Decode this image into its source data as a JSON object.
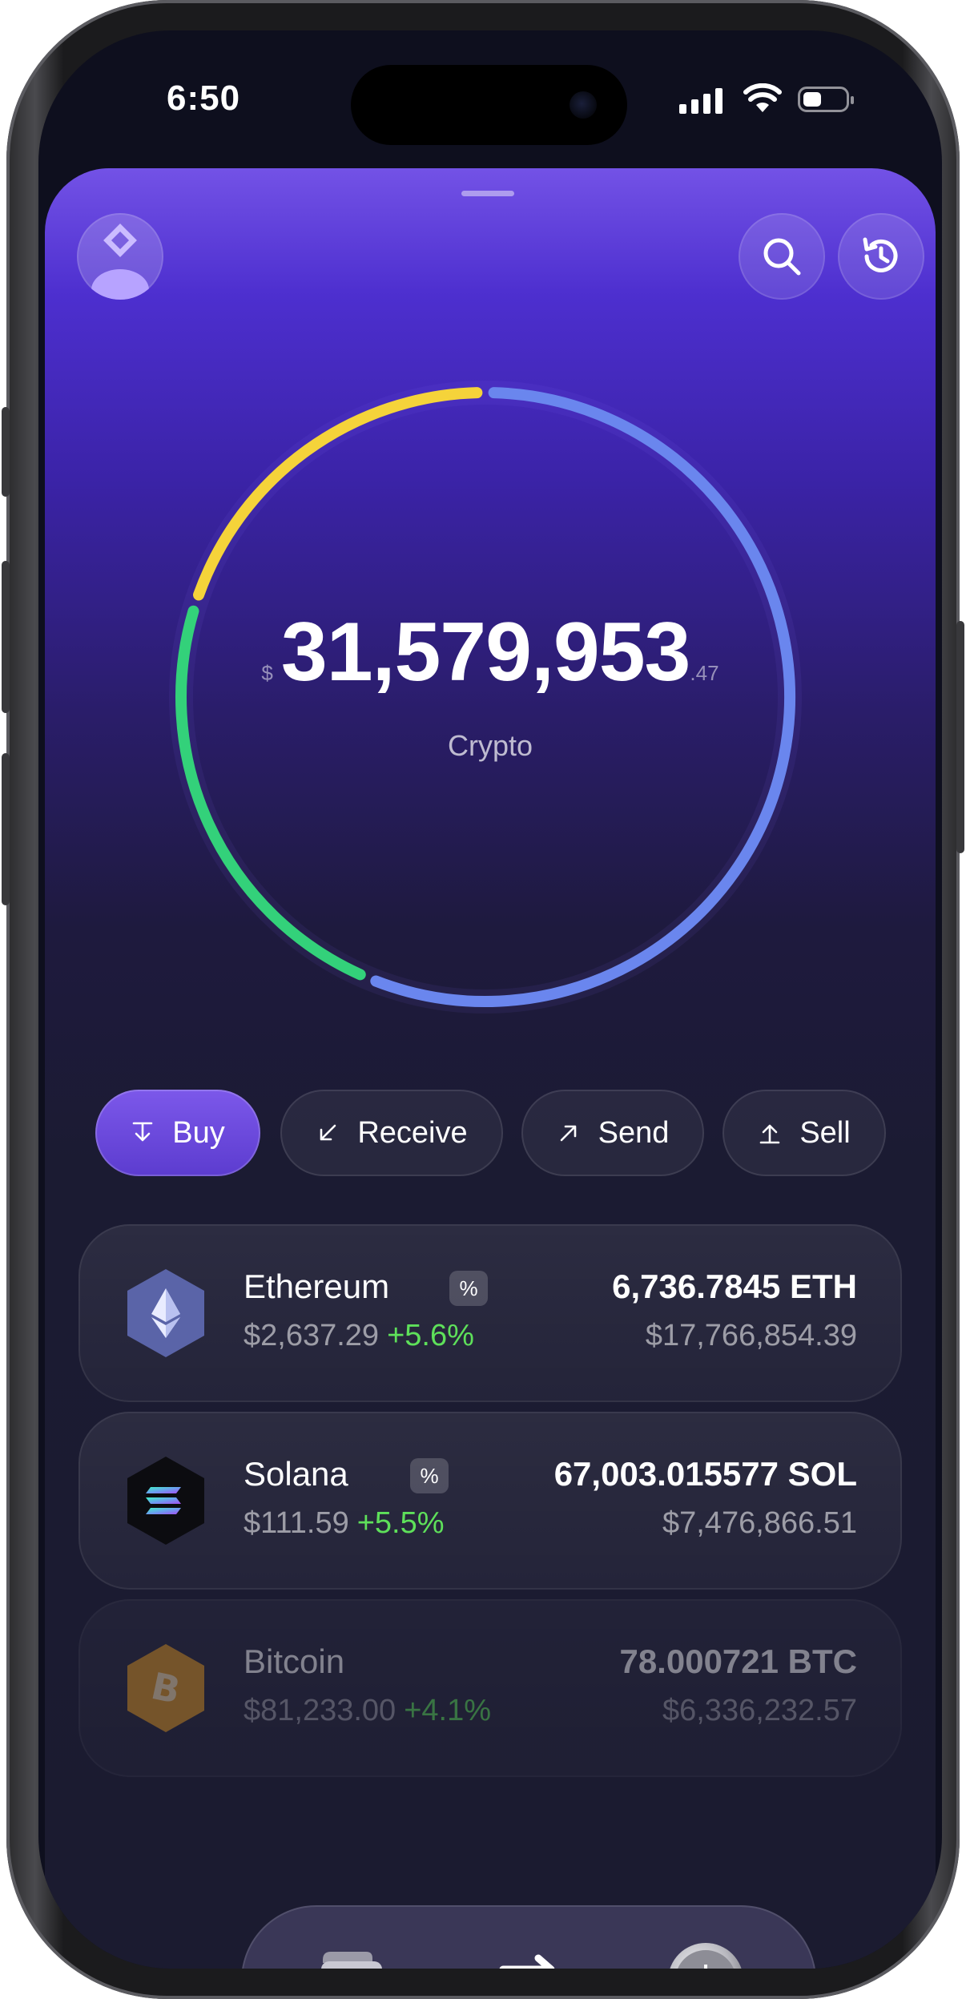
{
  "status": {
    "time": "6:50"
  },
  "header": {
    "avatar": "avatar-icon",
    "search": "search-icon",
    "history": "history-icon"
  },
  "portfolio": {
    "currency_symbol": "$",
    "amount": "31,579,953",
    "decimals": ".47",
    "caption": "Crypto",
    "allocation": [
      {
        "asset": "Ethereum",
        "fraction": 0.563,
        "color": "#6a86ee"
      },
      {
        "asset": "Solana",
        "fraction": 0.237,
        "color": "#33d17a"
      },
      {
        "asset": "Bitcoin",
        "fraction": 0.2,
        "color": "#f5d33a"
      }
    ]
  },
  "actions": [
    {
      "label": "Buy",
      "icon": "arrow-down-to-line-icon"
    },
    {
      "label": "Receive",
      "icon": "arrow-down-left-icon"
    },
    {
      "label": "Send",
      "icon": "arrow-up-right-icon"
    },
    {
      "label": "Sell",
      "icon": "arrow-up-to-line-icon"
    }
  ],
  "assets": [
    {
      "name": "Ethereum",
      "chip": "%",
      "price": "$2,637.29",
      "change": "+5.6%",
      "amount": "6,736.7845 ETH",
      "usd": "$17,766,854.39",
      "icon": "ethereum-icon"
    },
    {
      "name": "Solana",
      "chip": "%",
      "price": "$111.59",
      "change": "+5.5%",
      "amount": "67,003.015577 SOL",
      "usd": "$7,476,866.51",
      "icon": "solana-icon"
    },
    {
      "name": "Bitcoin",
      "price": "$81,233.00",
      "change": "+4.1%",
      "amount": "78.000721 BTC",
      "usd": "$6,336,232.57",
      "icon": "bitcoin-icon"
    }
  ],
  "tabbar": [
    {
      "icon": "wallet-icon"
    },
    {
      "icon": "swap-icon"
    },
    {
      "icon": "dollar-coin-icon"
    }
  ],
  "colors": {
    "accent": "#6444d8",
    "positive": "#5ee05a",
    "eth_ring": "#6a86ee",
    "sol_ring": "#33d17a",
    "btc_ring": "#f5d33a"
  }
}
